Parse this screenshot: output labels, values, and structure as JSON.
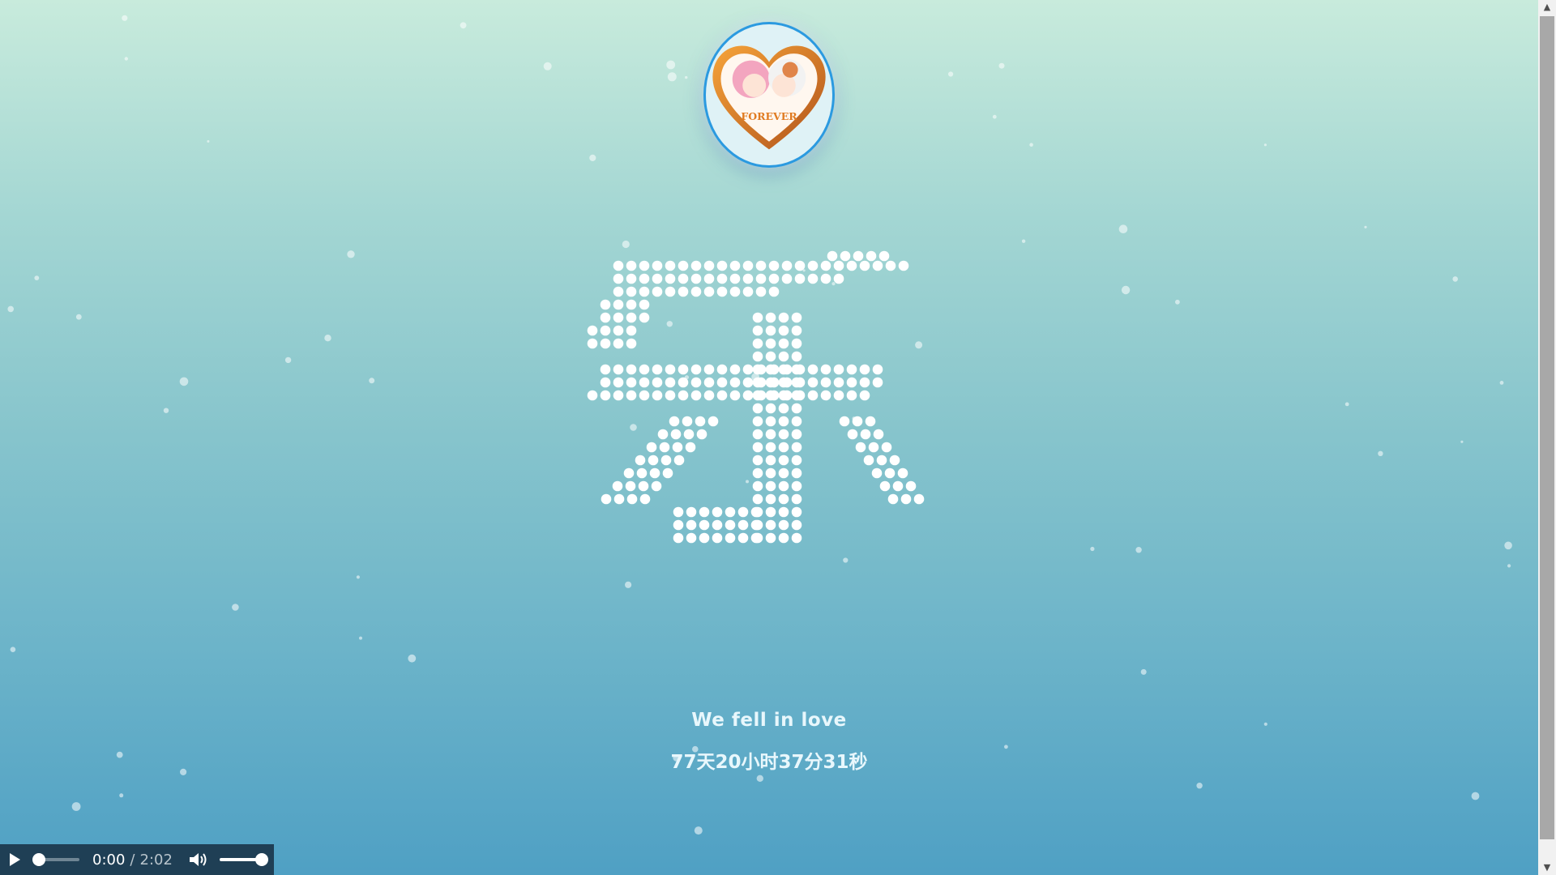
{
  "avatar": {
    "badge_text": "FOREVER"
  },
  "dot_art": {
    "character": "乐",
    "dot_color": "#ffffff"
  },
  "caption": {
    "title": "We fell in love",
    "timer": "77天20小时37分31秒"
  },
  "player": {
    "current_time": "0:00",
    "separator": "/",
    "total_time": "2:02",
    "progress": 0.0,
    "volume": 1.0,
    "play_icon": "play-icon",
    "volume_icon": "volume-icon"
  },
  "colors": {
    "bg_top": "#c8ebdc",
    "bg_bottom": "#4fa0c4",
    "accent_ring": "#2b9ae0",
    "player_bg": "#1f3f55"
  }
}
